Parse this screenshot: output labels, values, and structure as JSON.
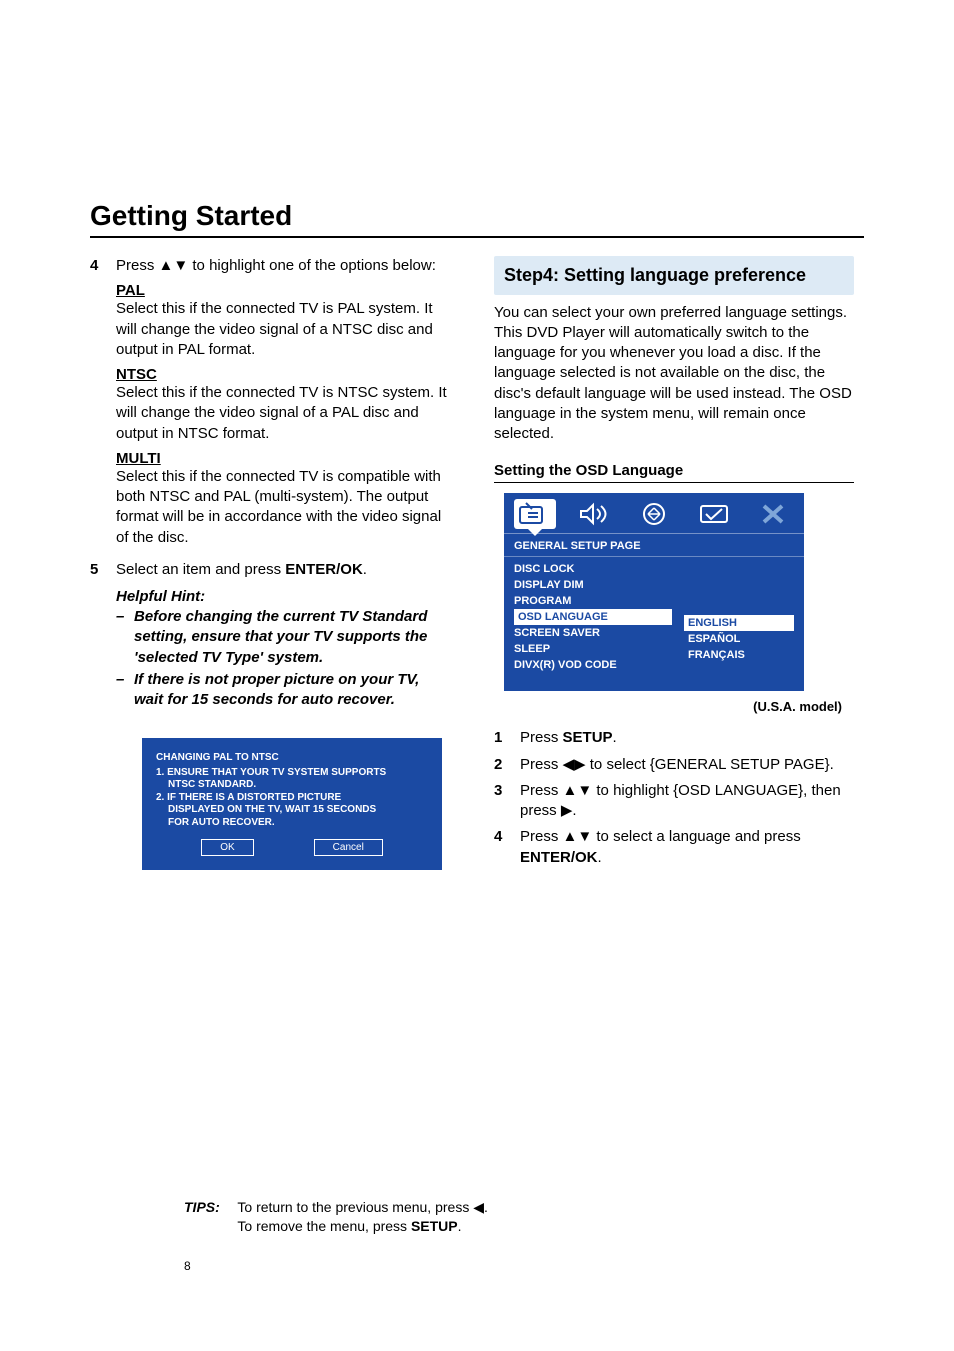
{
  "title": "Getting Started",
  "left": {
    "step4_num": "4",
    "step4_text_a": "Press ",
    "step4_text_b": " to highlight one of the options below:",
    "pal_head": "PAL",
    "pal_body": "Select this if the connected TV is PAL system. It will change the video signal of a NTSC disc and output in PAL format.",
    "ntsc_head": "NTSC",
    "ntsc_body": "Select this if the connected TV is NTSC system. It will change the video signal of a PAL disc and output in NTSC format.",
    "multi_head": "MULTI",
    "multi_body": "Select this if the connected TV is compatible with both NTSC and PAL (multi-system). The output format will be in accordance with the video signal of the disc.",
    "step5_num": "5",
    "step5_a": "Select an item and press ",
    "step5_b": "ENTER/OK",
    "step5_c": ".",
    "hint_label": "Helpful Hint:",
    "hints": [
      "Before changing the current TV Standard setting, ensure that your TV supports the 'selected TV Type' system.",
      "If there is not proper picture on your TV, wait for 15 seconds for auto recover."
    ],
    "bluebox": {
      "title": "CHANGING PAL TO NTSC",
      "l1": "1. ENSURE THAT YOUR TV SYSTEM SUPPORTS",
      "l1b": "NTSC STANDARD.",
      "l2": "2. IF THERE IS A DISTORTED PICTURE",
      "l2b": "DISPLAYED ON THE TV, WAIT 15 SECONDS",
      "l2c": "FOR AUTO RECOVER.",
      "ok": "OK",
      "cancel": "Cancel"
    }
  },
  "right": {
    "header": "Step4: Setting language preference",
    "intro": "You can select your own preferred language settings. This DVD Player will automatically switch to the language for you whenever you load a disc. If the language selected is not available on the disc, the disc's default language will be used instead. The OSD language in the system menu, will remain once selected.",
    "subhead": "Setting the OSD Language",
    "osd": {
      "title": "GENERAL SETUP PAGE",
      "left_items": [
        "DISC LOCK",
        "DISPLAY DIM",
        "PROGRAM",
        "OSD LANGUAGE",
        "SCREEN SAVER",
        "SLEEP",
        "DIVX(R) VOD CODE"
      ],
      "left_selected_index": 3,
      "right_items": [
        "ENGLISH",
        "ESPAÑOL",
        "FRANÇAIS"
      ],
      "right_selected_index": 0
    },
    "model_note": "(U.S.A. model)",
    "steps": [
      {
        "n": "1",
        "parts": [
          "Press ",
          "SETUP",
          "."
        ]
      },
      {
        "n": "2",
        "parts": [
          "Press ",
          "◀▶",
          " to select {GENERAL SETUP PAGE}."
        ],
        "arrow": true,
        "arrows": "lr"
      },
      {
        "n": "3",
        "parts": [
          "Press ",
          "▲▼",
          " to highlight {OSD LANGUAGE}, then press ",
          "▶",
          "."
        ],
        "arrow": true,
        "arrows": "ud_r"
      },
      {
        "n": "4",
        "parts": [
          "Press ",
          "▲▼",
          " to select a language and press ",
          "ENTER/OK",
          "."
        ],
        "arrow": true,
        "arrows": "ud"
      }
    ]
  },
  "tips": {
    "label": "TIPS:",
    "l1a": "To return to the previous menu, press ",
    "l1b": ".",
    "l2a": "To remove the menu, press ",
    "l2b": "SETUP",
    "l2c": "."
  },
  "page_number": "8",
  "glyphs": {
    "up_down": "▲▼",
    "left_right": "◀▶",
    "right": "▶",
    "left": "◀"
  }
}
